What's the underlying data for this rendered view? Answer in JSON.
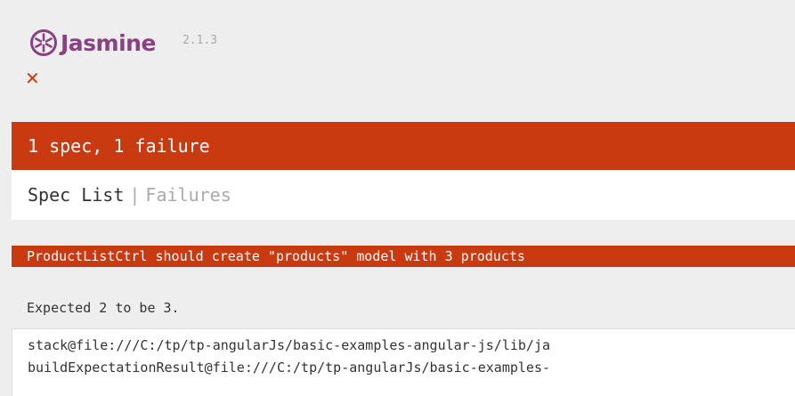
{
  "header": {
    "app_name": "Jasmine",
    "version": "2.1.3",
    "logo_icon": "jasmine-flower-icon",
    "failure_symbol": "✕",
    "brand_color": "#8a4182"
  },
  "summary": {
    "text": "1 spec, 1 failure",
    "color": "#ca3a11"
  },
  "menu": {
    "spec_list": "Spec List",
    "separator": "|",
    "failures": "Failures"
  },
  "failures": [
    {
      "title": "ProductListCtrl should create \"products\" model with 3 products",
      "message": "Expected 2 to be 3.",
      "stack": [
        "stack@file:///C:/tp/tp-angularJs/basic-examples-angular-js/lib/ja",
        "buildExpectationResult@file:///C:/tp/tp-angularJs/basic-examples-"
      ]
    }
  ]
}
